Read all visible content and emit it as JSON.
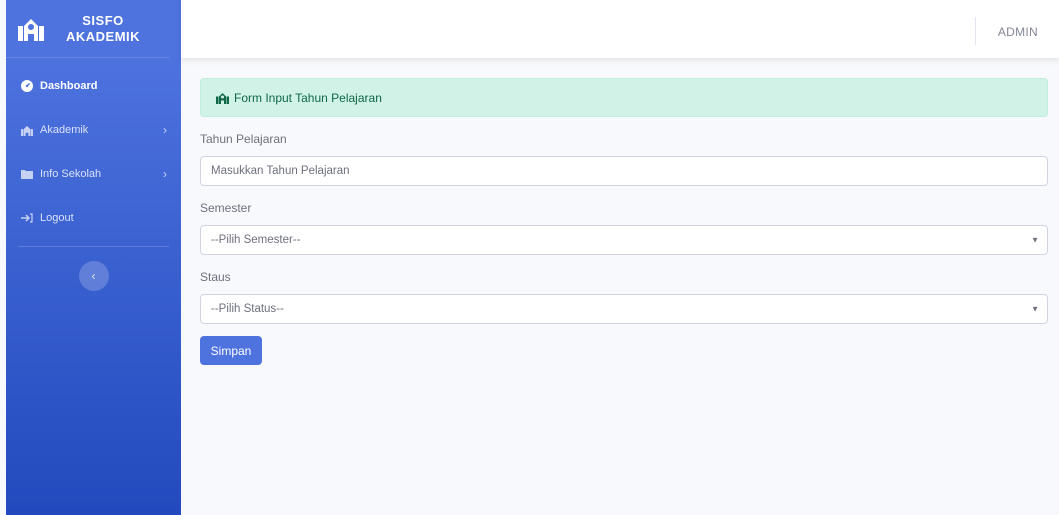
{
  "sidebar": {
    "brand": {
      "line1": "SISFO",
      "line2": "AKADEMIK",
      "icon": "school-icon"
    },
    "items": [
      {
        "label": "Dashboard",
        "icon": "tachometer-icon"
      },
      {
        "label": "Akademik",
        "icon": "school-icon"
      },
      {
        "label": "Info Sekolah",
        "icon": "folder-icon"
      },
      {
        "label": "Logout",
        "icon": "sign-out-icon"
      }
    ]
  },
  "topbar": {
    "user": "ADMIN"
  },
  "main": {
    "alert": {
      "text": "Form Input Tahun Pelajaran"
    },
    "fields": {
      "tahun": {
        "label": "Tahun Pelajaran",
        "placeholder": "Masukkan Tahun Pelajaran"
      },
      "semester": {
        "label": "Semester",
        "value": "--Pilih Semester--"
      },
      "status": {
        "label": "Staus",
        "value": "--Pilih Status--"
      }
    },
    "submit_label": "Simpan"
  },
  "colors": {
    "primary": "#4e73df",
    "primary_dark": "#224abe",
    "alert_bg": "#d1f2e6",
    "alert_text": "#0f6848"
  }
}
